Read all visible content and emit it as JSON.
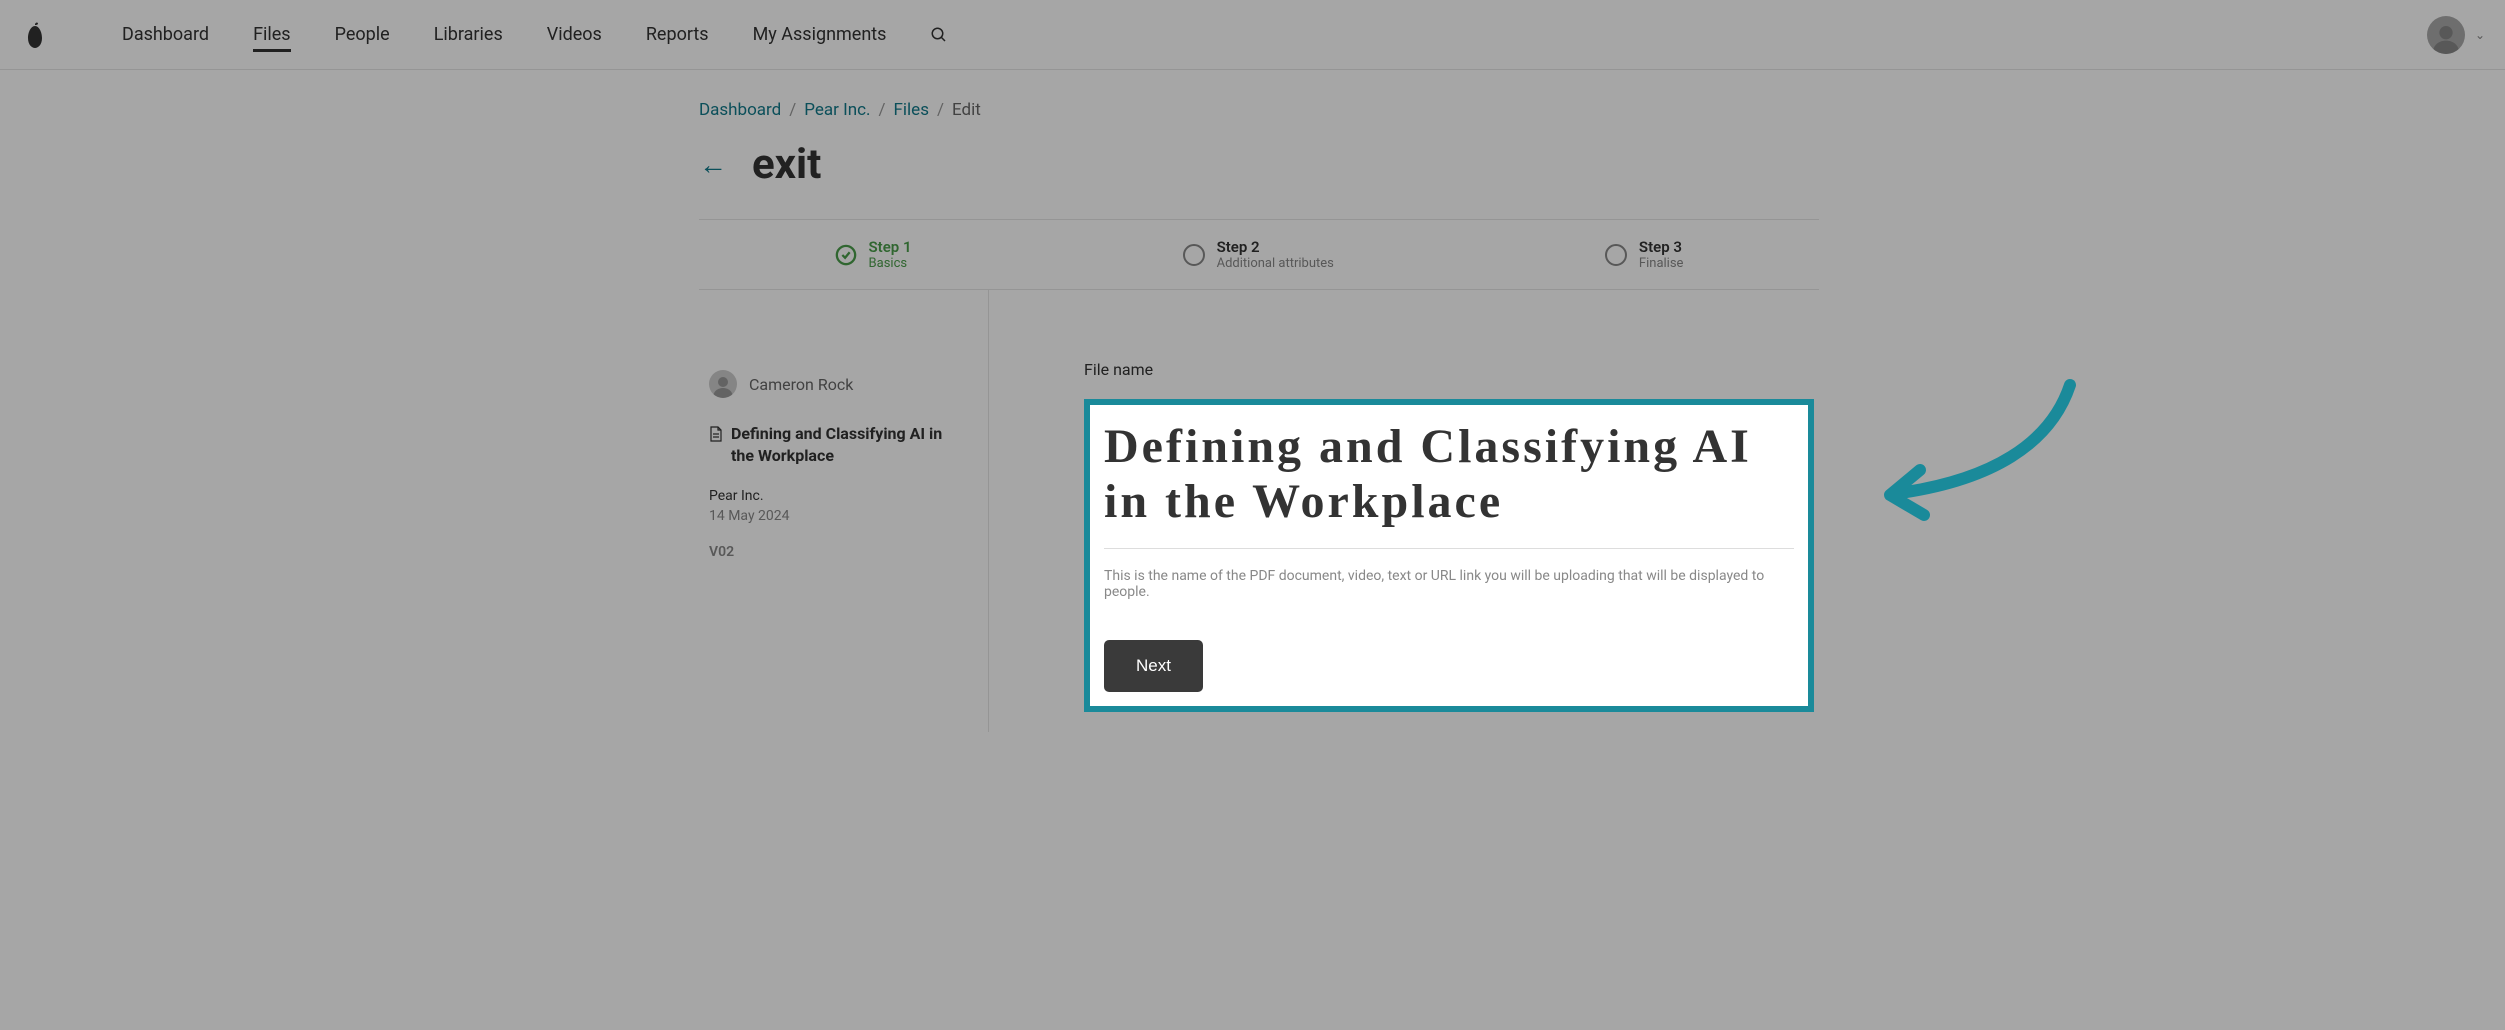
{
  "nav": {
    "items": [
      "Dashboard",
      "Files",
      "People",
      "Libraries",
      "Videos",
      "Reports",
      "My Assignments"
    ],
    "activeIndex": 1
  },
  "breadcrumb": {
    "items": [
      "Dashboard",
      "Pear Inc.",
      "Files"
    ],
    "current": "Edit"
  },
  "page": {
    "title": "exit"
  },
  "steps": [
    {
      "label": "Step 1",
      "sub": "Basics",
      "status": "done"
    },
    {
      "label": "Step 2",
      "sub": "Additional attributes",
      "status": "pending"
    },
    {
      "label": "Step 3",
      "sub": "Finalise",
      "status": "pending"
    }
  ],
  "sidebar": {
    "author": "Cameron Rock",
    "fileTitle": "Defining and Classifying AI in the Workplace",
    "company": "Pear Inc.",
    "date": "14 May 2024",
    "version": "V02"
  },
  "form": {
    "fieldLabel": "File name",
    "fileName": "Defining and Classifying AI in the Workplace",
    "helperText": "This is the name of the PDF document, video, text or URL link you will be uploading that will be displayed to people.",
    "nextButton": "Next"
  },
  "colors": {
    "accent": "#1a8a9a",
    "link": "#127a8a",
    "success": "#4a9d4a"
  }
}
